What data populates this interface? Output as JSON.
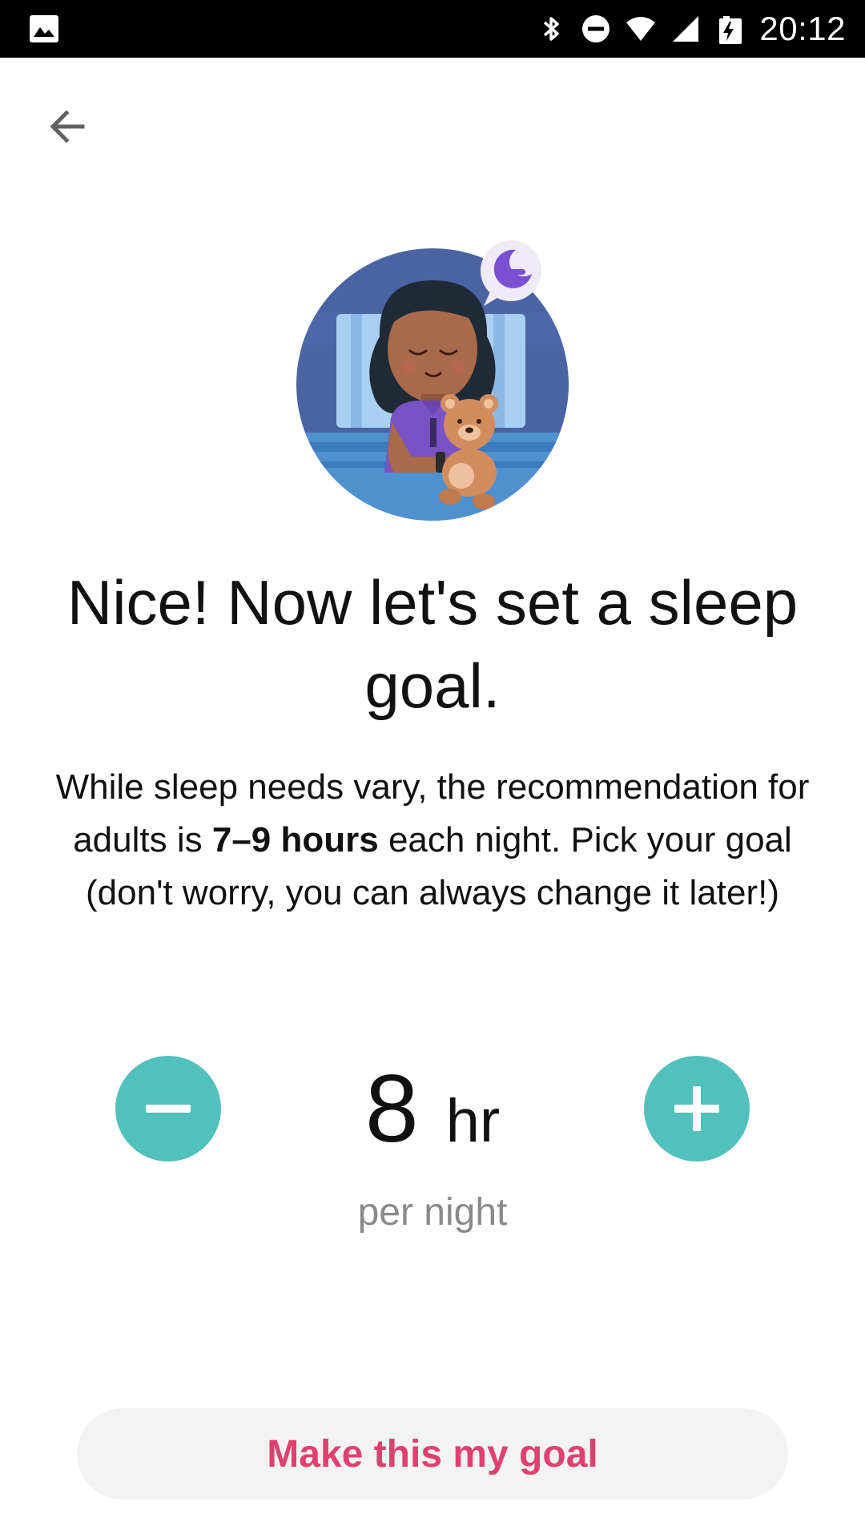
{
  "status_bar": {
    "time": "20:12",
    "left_icon": "image-icon",
    "right_icons": [
      "bluetooth-icon",
      "do-not-disturb-icon",
      "wifi-icon",
      "cell-signal-icon",
      "battery-charging-icon"
    ]
  },
  "nav": {
    "back_icon": "back-arrow-icon"
  },
  "illustration": {
    "subject": "woman-sleeping-with-teddy-bear-illustration",
    "badge_icon": "moon-icon"
  },
  "headline": "Nice! Now let's set a sleep goal.",
  "body": {
    "part1": "While sleep needs vary, the recommendation for adults is ",
    "bold": "7–9 hours",
    "part2": " each night. Pick your goal (don't worry, you can always change it later!)"
  },
  "goal": {
    "value": "8",
    "unit": "hr",
    "caption": "per night"
  },
  "cta_label": "Make this my goal",
  "colors": {
    "accent_teal": "#52c0bd",
    "cta_text": "#e0406f",
    "cta_bg": "#f3f3f3",
    "illustration_bg": "#4a64a3",
    "moon_purple": "#7a4fd1"
  }
}
